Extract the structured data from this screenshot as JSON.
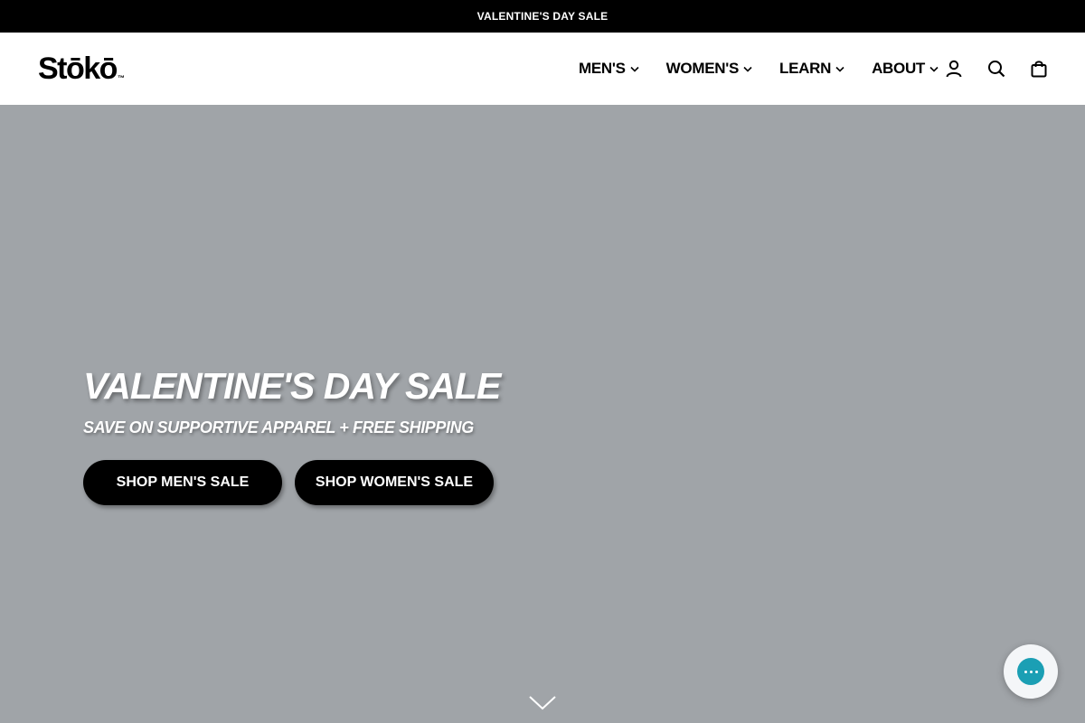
{
  "announcement": {
    "text": "VALENTINE'S DAY SALE"
  },
  "header": {
    "logo": "Stōkō",
    "logo_tm": "™",
    "nav": [
      {
        "label": "MEN'S",
        "icon": "chevron-down-icon"
      },
      {
        "label": "WOMEN'S",
        "icon": "chevron-down-icon"
      },
      {
        "label": "LEARN",
        "icon": "chevron-down-icon"
      },
      {
        "label": "ABOUT",
        "icon": "chevron-down-icon"
      }
    ],
    "icons": [
      "account-icon",
      "search-icon",
      "cart-icon"
    ]
  },
  "hero": {
    "title": "VALENTINE'S DAY SALE",
    "subtitle": "SAVE ON SUPPORTIVE APPAREL + FREE SHIPPING",
    "cta_men": "SHOP MEN'S SALE",
    "cta_women": "SHOP WOMEN'S SALE",
    "background_color": "#a0a4a8"
  },
  "chat": {
    "icon": "chat-bubble-icon",
    "accent": "#1b9fb4"
  }
}
